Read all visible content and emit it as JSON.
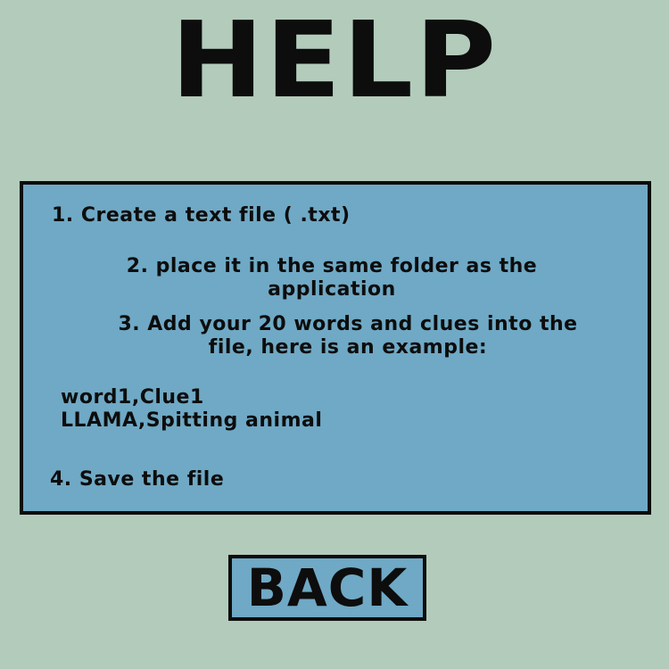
{
  "page": {
    "title": "HELP"
  },
  "instructions": {
    "step1": "1. Create a text file ( .txt)",
    "step2_line1": "2. place it in the same folder as the",
    "step2_line2": "application",
    "step3_line1": "3. Add your 20 words and clues into the",
    "step3_line2": "file, here is an example:",
    "example_line1": "word1,Clue1",
    "example_line2": "LLAMA,Spitting animal",
    "step4": "4. Save the file"
  },
  "back_button": {
    "label": "BACK"
  },
  "colors": {
    "background": "#b3cbbb",
    "panel": "#6fa9c5",
    "text": "#0d0d0d"
  }
}
